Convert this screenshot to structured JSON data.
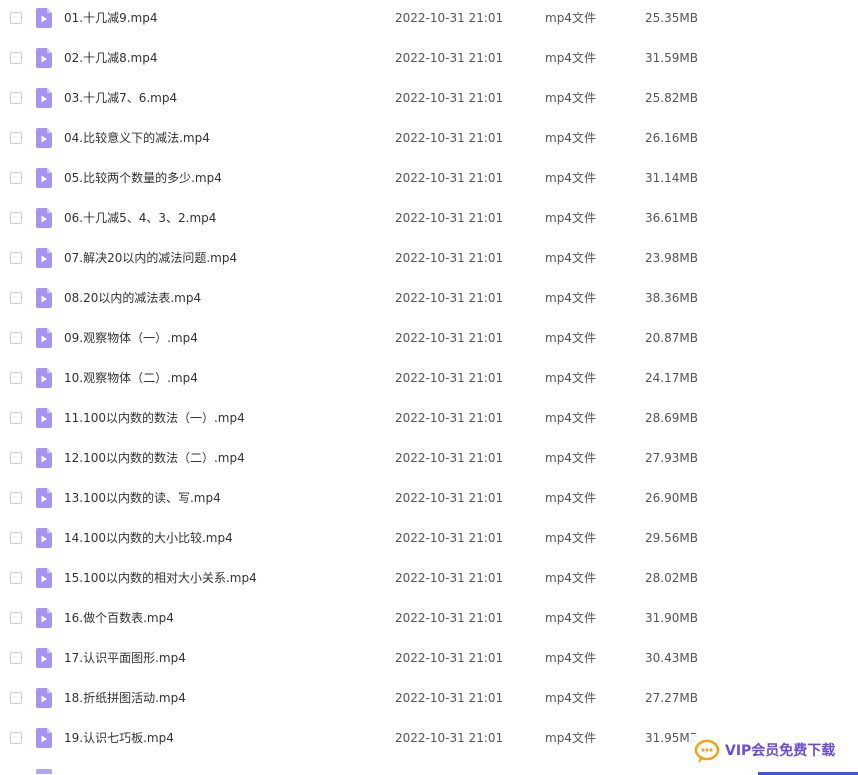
{
  "files": [
    {
      "name": "01.十几减9.mp4",
      "date": "2022-10-31 21:01",
      "type": "mp4文件",
      "size": "25.35MB"
    },
    {
      "name": "02.十几减8.mp4",
      "date": "2022-10-31 21:01",
      "type": "mp4文件",
      "size": "31.59MB"
    },
    {
      "name": "03.十几减7、6.mp4",
      "date": "2022-10-31 21:01",
      "type": "mp4文件",
      "size": "25.82MB"
    },
    {
      "name": "04.比较意义下的减法.mp4",
      "date": "2022-10-31 21:01",
      "type": "mp4文件",
      "size": "26.16MB"
    },
    {
      "name": "05.比较两个数量的多少.mp4",
      "date": "2022-10-31 21:01",
      "type": "mp4文件",
      "size": "31.14MB"
    },
    {
      "name": "06.十几减5、4、3、2.mp4",
      "date": "2022-10-31 21:01",
      "type": "mp4文件",
      "size": "36.61MB"
    },
    {
      "name": "07.解决20以内的减法问题.mp4",
      "date": "2022-10-31 21:01",
      "type": "mp4文件",
      "size": "23.98MB"
    },
    {
      "name": "08.20以内的减法表.mp4",
      "date": "2022-10-31 21:01",
      "type": "mp4文件",
      "size": "38.36MB"
    },
    {
      "name": "09.观察物体（一）.mp4",
      "date": "2022-10-31 21:01",
      "type": "mp4文件",
      "size": "20.87MB"
    },
    {
      "name": "10.观察物体（二）.mp4",
      "date": "2022-10-31 21:01",
      "type": "mp4文件",
      "size": "24.17MB"
    },
    {
      "name": "11.100以内数的数法（一）.mp4",
      "date": "2022-10-31 21:01",
      "type": "mp4文件",
      "size": "28.69MB"
    },
    {
      "name": "12.100以内数的数法（二）.mp4",
      "date": "2022-10-31 21:01",
      "type": "mp4文件",
      "size": "27.93MB"
    },
    {
      "name": "13.100以内数的读、写.mp4",
      "date": "2022-10-31 21:01",
      "type": "mp4文件",
      "size": "26.90MB"
    },
    {
      "name": "14.100以内数的大小比较.mp4",
      "date": "2022-10-31 21:01",
      "type": "mp4文件",
      "size": "29.56MB"
    },
    {
      "name": "15.100以内数的相对大小关系.mp4",
      "date": "2022-10-31 21:01",
      "type": "mp4文件",
      "size": "28.02MB"
    },
    {
      "name": "16.做个百数表.mp4",
      "date": "2022-10-31 21:01",
      "type": "mp4文件",
      "size": "31.90MB"
    },
    {
      "name": "17.认识平面图形.mp4",
      "date": "2022-10-31 21:01",
      "type": "mp4文件",
      "size": "30.43MB"
    },
    {
      "name": "18.折纸拼图活动.mp4",
      "date": "2022-10-31 21:01",
      "type": "mp4文件",
      "size": "27.27MB"
    },
    {
      "name": "19.认识七巧板.mp4",
      "date": "2022-10-31 21:01",
      "type": "mp4文件",
      "size": "31.95MB"
    }
  ],
  "icons": {
    "file": "video-file-icon",
    "vip": "chat-bubble-icon"
  },
  "colors": {
    "file_icon": "#a793f0",
    "file_icon_fold": "#d4c9fa",
    "vip_text": "#6c4bdc",
    "vip_icon": "#f2a31b"
  },
  "vip_banner": {
    "label": "VIP会员免费下载"
  }
}
